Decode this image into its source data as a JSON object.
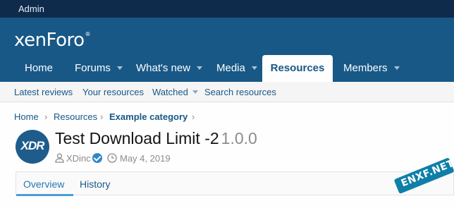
{
  "staffbar": {
    "admin_label": "Admin"
  },
  "header": {
    "logo": "xenForo",
    "logo_mark": "®"
  },
  "nav": {
    "items": [
      {
        "label": "Home",
        "has_menu": false
      },
      {
        "label": "Forums",
        "has_menu": true
      },
      {
        "label": "What's new",
        "has_menu": true
      },
      {
        "label": "Media",
        "has_menu": true
      },
      {
        "label": "Resources",
        "has_menu": false,
        "active": true
      },
      {
        "label": "Members",
        "has_menu": true
      }
    ]
  },
  "subnav": {
    "items": [
      {
        "label": "Latest reviews"
      },
      {
        "label": "Your resources"
      },
      {
        "label": "Watched",
        "has_menu": true
      },
      {
        "label": "Search resources"
      }
    ]
  },
  "breadcrumb": {
    "items": [
      "Home",
      "Resources",
      "Example category"
    ],
    "separator": "›"
  },
  "resource": {
    "avatar_text": "XDR",
    "title": "Test Download Limit -2",
    "version": "1.0.0",
    "author": "XDinc",
    "date": "May 4, 2019"
  },
  "tabs": {
    "items": [
      {
        "label": "Overview",
        "active": true
      },
      {
        "label": "History"
      }
    ]
  },
  "watermark": {
    "text": "ENXF.NET"
  },
  "colors": {
    "staffbar": "#0f2b4c",
    "header": "#185886",
    "link": "#185886",
    "accent": "#4a9ed9",
    "verified": "#2f86c9"
  },
  "icons": {
    "author": "user-icon",
    "verified": "verified-check-icon",
    "date": "clock-icon",
    "menu": "chevron-down-icon"
  }
}
